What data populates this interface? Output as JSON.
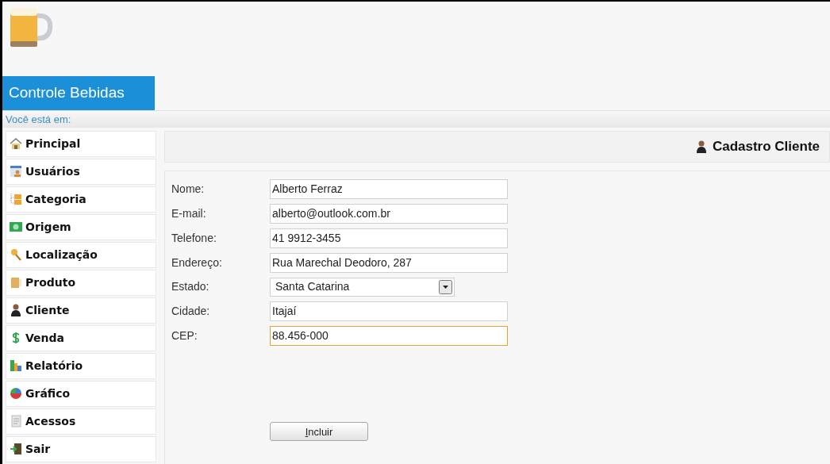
{
  "header": {
    "title": "Controle Bebidas"
  },
  "breadcrumb": {
    "label": "Você está em:"
  },
  "sidebar": {
    "items": [
      {
        "label": "Principal"
      },
      {
        "label": "Usuários"
      },
      {
        "label": "Categoria"
      },
      {
        "label": "Origem"
      },
      {
        "label": "Localização"
      },
      {
        "label": "Produto"
      },
      {
        "label": "Cliente"
      },
      {
        "label": "Venda"
      },
      {
        "label": "Relatório"
      },
      {
        "label": "Gráfico"
      },
      {
        "label": "Acessos"
      },
      {
        "label": "Sair"
      }
    ]
  },
  "page_title": "Cadastro Cliente",
  "form": {
    "fields": [
      {
        "label": "Nome:",
        "kind": "text",
        "value": "Alberto Ferraz",
        "focused": false
      },
      {
        "label": "E-mail:",
        "kind": "text",
        "value": "alberto@outlook.com.br",
        "focused": false
      },
      {
        "label": "Telefone:",
        "kind": "text",
        "value": "41 9912-3455",
        "focused": false
      },
      {
        "label": "Endereço:",
        "kind": "text",
        "value": "Rua Marechal Deodoro, 287",
        "focused": false
      },
      {
        "label": "Estado:",
        "kind": "select",
        "value": "Santa Catarina",
        "focused": false
      },
      {
        "label": "Cidade:",
        "kind": "text",
        "value": "Itajaí",
        "focused": false
      },
      {
        "label": "CEP:",
        "kind": "text",
        "value": "88.456-000",
        "focused": true
      }
    ],
    "submit": {
      "label": "Incluir",
      "underline_first": true
    }
  }
}
